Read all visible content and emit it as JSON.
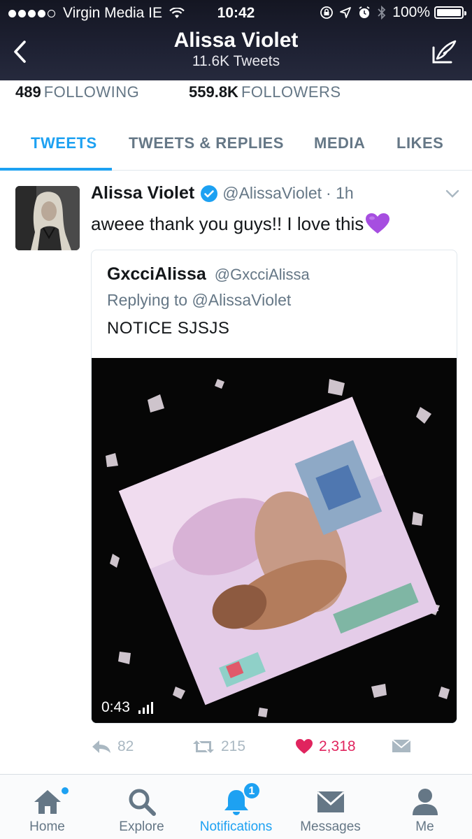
{
  "status_bar": {
    "carrier": "Virgin Media IE",
    "time": "10:42",
    "battery": "100%",
    "signal_dots_filled": 4,
    "signal_dots_total": 5
  },
  "header": {
    "title": "Alissa Violet",
    "subtitle": "11.6K Tweets",
    "back_icon": "chevron-left-icon",
    "compose_icon": "compose-tweet-icon"
  },
  "stats": {
    "following_count": "489",
    "following_label": "FOLLOWING",
    "followers_count": "559.8K",
    "followers_label": "FOLLOWERS"
  },
  "tabs": [
    {
      "label": "TWEETS",
      "active": true
    },
    {
      "label": "TWEETS & REPLIES",
      "active": false
    },
    {
      "label": "MEDIA",
      "active": false
    },
    {
      "label": "LIKES",
      "active": false
    }
  ],
  "tweet": {
    "author_name": "Alissa Violet",
    "author_handle": "@AlissaViolet",
    "time": "· 1h",
    "text": "aweee thank you guys!! I love this",
    "emoji": "purple-heart",
    "quoted": {
      "name": "GxcciAlissa",
      "handle": "@GxcciAlissa",
      "replying_to": "Replying to @AlissaViolet",
      "text": "NOTICE SJSJS",
      "media": {
        "type": "video",
        "duration": "0:43"
      }
    },
    "actions": {
      "reply_count": "82",
      "retweet_count": "215",
      "like_count": "2,318",
      "liked": true
    }
  },
  "bottom_nav": [
    {
      "label": "Home",
      "icon": "home-icon",
      "active": false
    },
    {
      "label": "Explore",
      "icon": "search-icon",
      "active": false
    },
    {
      "label": "Notifications",
      "icon": "bell-icon",
      "active": true,
      "badge": "1"
    },
    {
      "label": "Messages",
      "icon": "envelope-icon",
      "active": false
    },
    {
      "label": "Me",
      "icon": "person-icon",
      "active": false
    }
  ],
  "colors": {
    "accent": "#1da1f2",
    "like": "#e0245e",
    "secondary_text": "#657786",
    "header_bg": "#1e2133"
  }
}
